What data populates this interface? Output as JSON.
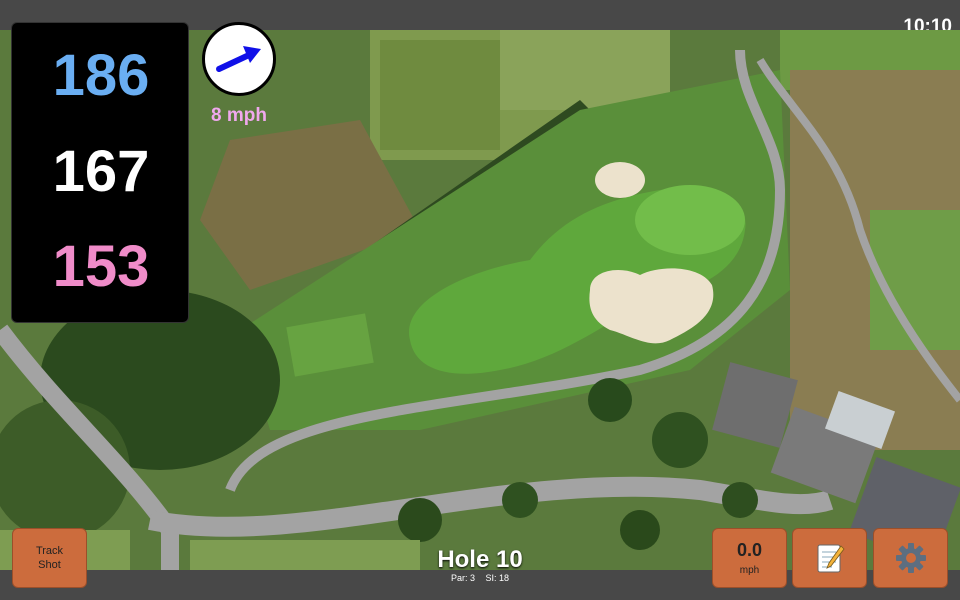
{
  "status_bar": {
    "time": "10:10"
  },
  "distances": {
    "back": "186",
    "middle": "167",
    "front": "153",
    "colors": {
      "back": "#6aaef2",
      "middle": "#ffffff",
      "front": "#f08cc9"
    }
  },
  "wind": {
    "speed": "8 mph",
    "arrow_color": "#1010e8",
    "text_color": "#f0a8ee"
  },
  "buttons": {
    "track_shot": {
      "line1": "Track",
      "line2": "Shot"
    },
    "speed": {
      "value": "0.0",
      "unit": "mph"
    },
    "notes": {
      "icon": "notepad-icon"
    },
    "settings": {
      "icon": "gear-icon"
    }
  },
  "hole": {
    "title": "Hole 10",
    "par": "Par: 3",
    "stroke_index": "SI: 18"
  },
  "theme": {
    "button_color": "#cc6c3d",
    "bar_color": "#484848"
  }
}
